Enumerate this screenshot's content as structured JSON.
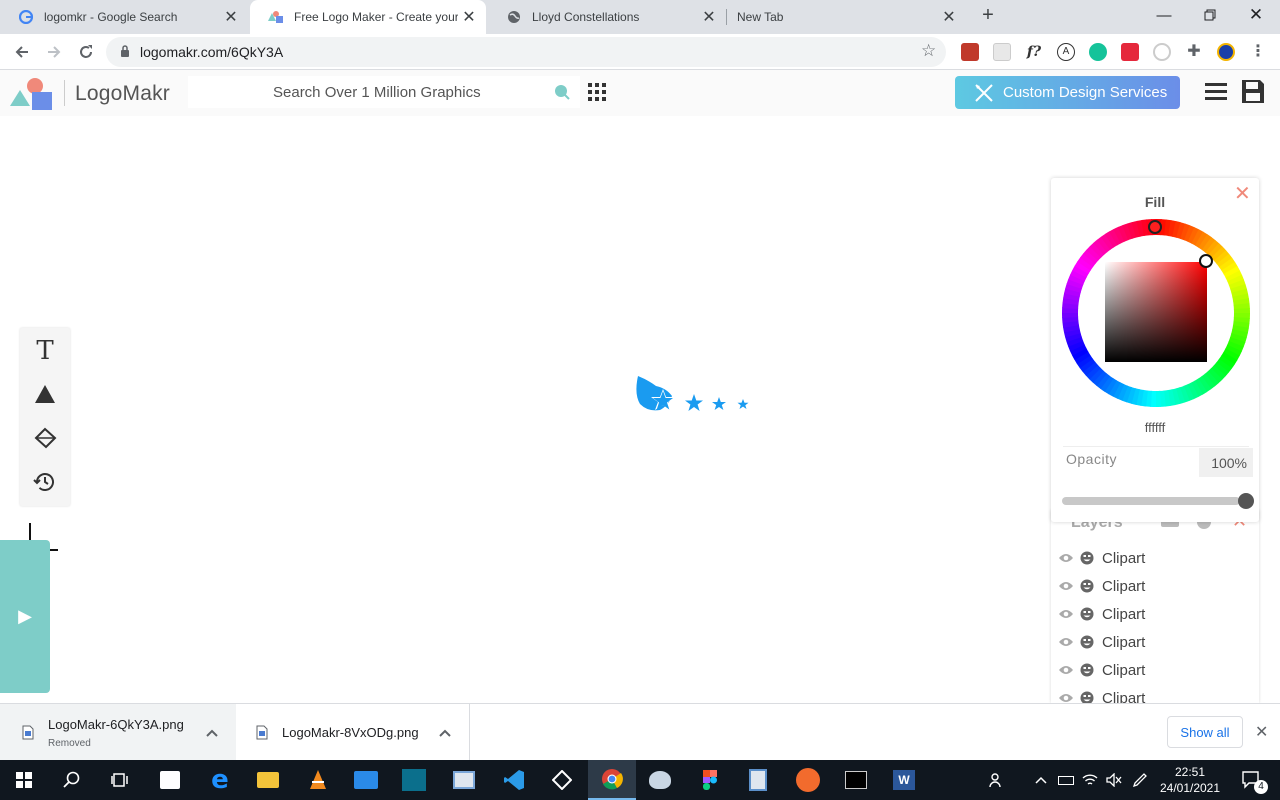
{
  "browser": {
    "tabs": [
      {
        "title": "logomkr - Google Search",
        "favicon": "google-icon"
      },
      {
        "title": "Free Logo Maker - Create your o",
        "favicon": "logomakr-icon",
        "active": true
      },
      {
        "title": "Lloyd Constellations",
        "favicon": "globe-icon"
      },
      {
        "title": "New Tab",
        "favicon": "none"
      }
    ],
    "url": "logomakr.com/6QkY3A"
  },
  "app": {
    "brand": "LogoMakr",
    "search_placeholder": "Search Over 1 Million Graphics",
    "custom_design_label": "Custom Design Services"
  },
  "fill_panel": {
    "title": "Fill",
    "hex": "ffffff",
    "opacity_label": "Opacity",
    "opacity_value": "100%",
    "opacity_level": 1.0
  },
  "layers": {
    "title": "Layers",
    "items": [
      {
        "label": "Clipart"
      },
      {
        "label": "Clipart"
      },
      {
        "label": "Clipart"
      },
      {
        "label": "Clipart"
      },
      {
        "label": "Clipart"
      },
      {
        "label": "Clipart"
      }
    ]
  },
  "downloads": [
    {
      "name": "LogoMakr-6QkY3A.png",
      "status": "Removed"
    },
    {
      "name": "LogoMakr-8VxODg.png",
      "status": ""
    }
  ],
  "download_bar": {
    "show_all": "Show all"
  },
  "taskbar": {
    "time": "22:51",
    "date": "24/01/2021",
    "notification_count": "4"
  },
  "colors": {
    "accent_teal": "#7ecdc8",
    "star_blue": "#1a9bf0",
    "close_salmon": "#f0897a"
  }
}
